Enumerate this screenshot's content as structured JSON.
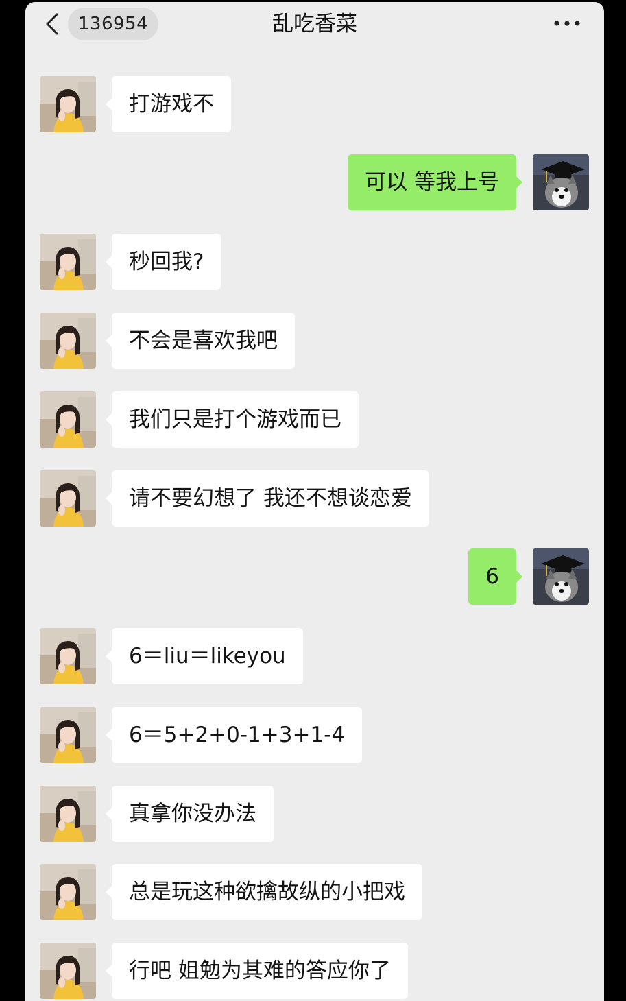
{
  "header": {
    "unread_count": "136954",
    "title": "乱吃香菜"
  },
  "icons": {
    "back": "chevron-left-icon",
    "more": "more-dots-icon"
  },
  "colors": {
    "background": "#ededed",
    "sent_bubble": "#95ec69",
    "received_bubble": "#ffffff"
  },
  "messages": [
    {
      "side": "left",
      "text": "打游戏不"
    },
    {
      "side": "right",
      "text": "可以 等我上号"
    },
    {
      "side": "left",
      "text": "秒回我?"
    },
    {
      "side": "left",
      "text": "不会是喜欢我吧"
    },
    {
      "side": "left",
      "text": "我们只是打个游戏而已"
    },
    {
      "side": "left",
      "text": "请不要幻想了 我还不想谈恋爱"
    },
    {
      "side": "right",
      "text": "6"
    },
    {
      "side": "left",
      "text": "6＝liu＝likeyou"
    },
    {
      "side": "left",
      "text": "6＝5+2+0-1+3+1-4"
    },
    {
      "side": "left",
      "text": "真拿你没办法"
    },
    {
      "side": "left",
      "text": "总是玩这种欲擒故纵的小把戏"
    },
    {
      "side": "left",
      "text": "行吧 姐勉为其难的答应你了"
    }
  ]
}
